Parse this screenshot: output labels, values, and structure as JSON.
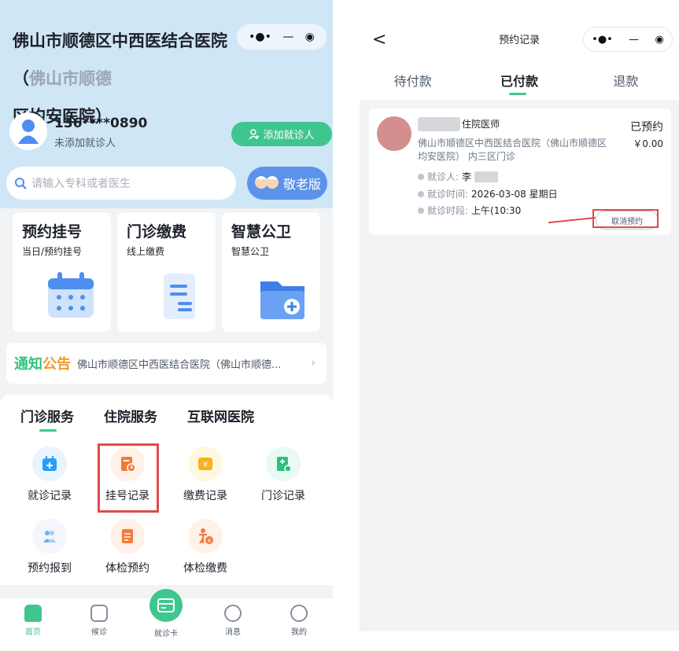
{
  "left": {
    "hospital_title": "佛山市顺德区中西医结合医院（",
    "hospital_title_faded": "佛山市顺德",
    "hospital_title_line2": "区均安医院）",
    "capsule": {
      "more": "•●•",
      "minus": "—",
      "target": "◉"
    },
    "user": {
      "phone": "136****0890",
      "status": "未添加就诊人",
      "add_button": "添加就诊人"
    },
    "search": {
      "placeholder": "请输入专科或者医生"
    },
    "elder_mode": "敬老版",
    "cards": [
      {
        "title": "预约挂号",
        "subtitle": "当日/预约挂号"
      },
      {
        "title": "门诊缴费",
        "subtitle": "线上缴费"
      },
      {
        "title": "智慧公卫",
        "subtitle": "智慧公卫"
      }
    ],
    "notice": {
      "tag_a": "通知",
      "tag_b": "公告",
      "text": "佛山市顺德区中西医结合医院（佛山市顺德...",
      "arrow": "›"
    },
    "service_tabs": [
      "门诊服务",
      "住院服务",
      "互联网医院"
    ],
    "services": [
      {
        "label": "就诊记录",
        "color": "#e8f4ff"
      },
      {
        "label": "挂号记录",
        "color": "#fff1e8"
      },
      {
        "label": "缴费记录",
        "color": "#fff7e0"
      },
      {
        "label": "门诊记录",
        "color": "#e8faf2"
      },
      {
        "label": "预约报到",
        "color": "#f3f6fa"
      },
      {
        "label": "体检预约",
        "color": "#fff1e8"
      },
      {
        "label": "体检缴费",
        "color": "#fff1e8"
      }
    ],
    "nav": [
      {
        "label": "首页"
      },
      {
        "label": "候诊"
      },
      {
        "label": "就诊卡"
      },
      {
        "label": "消息"
      },
      {
        "label": "我的"
      }
    ]
  },
  "right": {
    "back": "<",
    "title": "预约记录",
    "capsule": {
      "more": "•●•",
      "minus": "—",
      "target": "◉"
    },
    "tabs": [
      "待付款",
      "已付款",
      "退款"
    ],
    "record": {
      "doctor_title": "住院医师",
      "status": "已预约",
      "hospital": "佛山市顺德区中西医结合医院（佛山市顺德区均安医院） 内三区门诊",
      "price": "￥0.00",
      "patient_label": "就诊人:",
      "patient_value": "李",
      "time_label": "就诊时间:",
      "time_value": "2026-03-08 星期日",
      "period_label": "就诊时段:",
      "period_value": "上午(10:30",
      "cancel_button": "取消预约"
    }
  },
  "colors": {
    "accent": "#3fc68f",
    "highlight": "#e14a4a",
    "header_bg": "#cfe6f7"
  }
}
